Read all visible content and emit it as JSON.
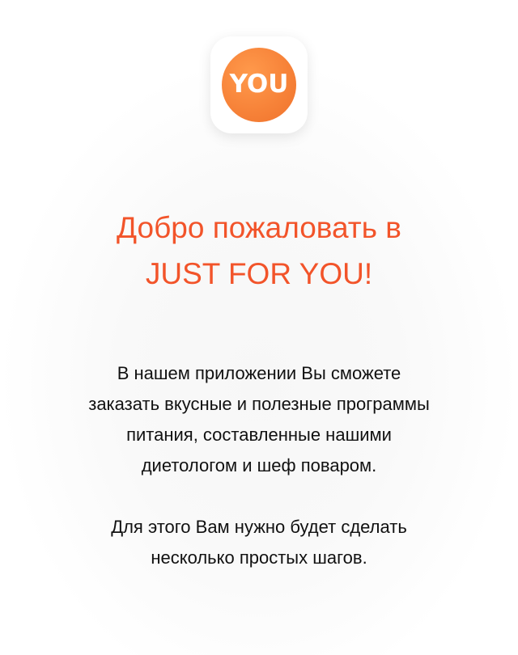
{
  "logo": {
    "text": "YOU",
    "accent_color": "#f78339"
  },
  "title": {
    "line1": "Добро пожаловать в",
    "line2": "JUST FOR YOU!",
    "color": "#f2542a"
  },
  "description": {
    "paragraph1": [
      "В нашем приложении Вы сможете",
      "заказать вкусные и полезные программы",
      "питания, составленные нашими",
      "диетологом и шеф поваром."
    ],
    "paragraph2": [
      "Для этого Вам нужно будет сделать",
      "несколько простых шагов."
    ]
  }
}
